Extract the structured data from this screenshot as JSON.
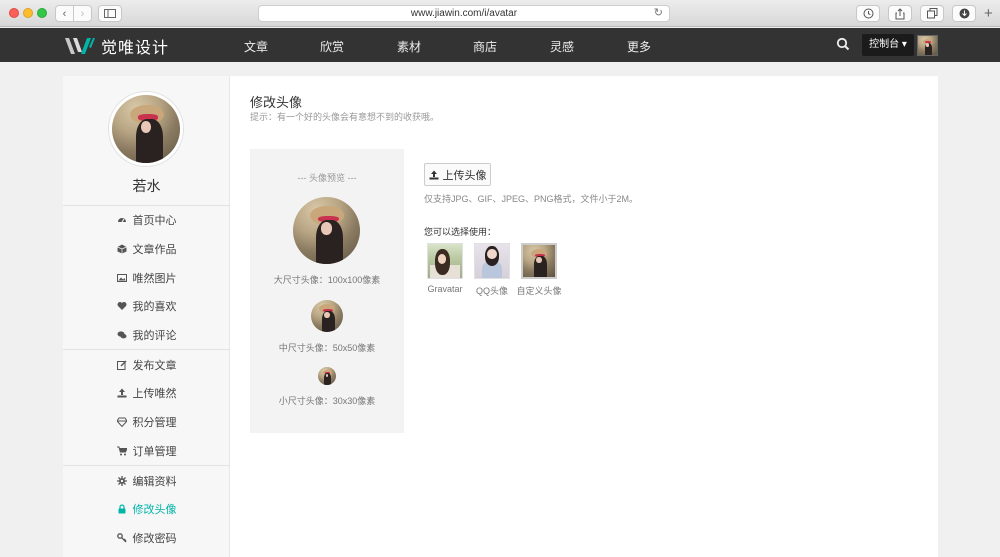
{
  "browser": {
    "url": "www.jiawin.com/i/avatar"
  },
  "site": {
    "logo_text": "觉唯设计",
    "nav": [
      "文章",
      "欣赏",
      "素材",
      "商店",
      "灵感",
      "更多"
    ],
    "console_label": "控制台 ▾"
  },
  "profile": {
    "name": "若水"
  },
  "menu": {
    "group1": [
      "首页中心",
      "文章作品",
      "唯然图片",
      "我的喜欢",
      "我的评论"
    ],
    "group2": [
      "发布文章",
      "上传唯然",
      "积分管理",
      "订单管理"
    ],
    "group3": [
      "编辑资料",
      "修改头像",
      "修改密码"
    ],
    "active": "修改头像"
  },
  "main": {
    "title": "修改头像",
    "tip": "提示：有一个好的头像会有意想不到的收获哦。",
    "preview": {
      "title": "--- 头像预览 ---",
      "large_label": "大尺寸头像：100x100像素",
      "mid_label": "中尺寸头像：50x50像素",
      "small_label": "小尺寸头像：30x30像素"
    },
    "upload_label": "上传头像",
    "upload_hint": "仅支持JPG、GIF、JPEG、PNG格式，文件小于2M。",
    "choose_label": "您可以选择使用：",
    "choices": [
      "Gravatar",
      "QQ头像",
      "自定义头像"
    ]
  },
  "colors": {
    "header_bg": "#333333",
    "accent": "#00b4a8"
  }
}
